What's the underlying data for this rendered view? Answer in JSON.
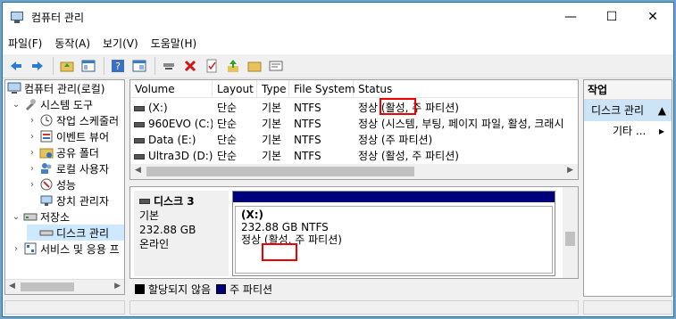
{
  "window": {
    "title": "컴퓨터 관리"
  },
  "menu": [
    "파일(F)",
    "동작(A)",
    "보기(V)",
    "도움말(H)"
  ],
  "tree": {
    "items": [
      {
        "label": "컴퓨터 관리(로컬)"
      },
      {
        "label": "시스템 도구"
      },
      {
        "label": "작업 스케줄러"
      },
      {
        "label": "이벤트 뷰어"
      },
      {
        "label": "공유 폴더"
      },
      {
        "label": "로컬 사용자"
      },
      {
        "label": "성능"
      },
      {
        "label": "장치 관리자"
      },
      {
        "label": "저장소"
      },
      {
        "label": "디스크 관리"
      },
      {
        "label": "서비스 및 응용 프"
      }
    ]
  },
  "table": {
    "columns": [
      "Volume",
      "Layout",
      "Type",
      "File System",
      "Status"
    ],
    "rows": [
      {
        "volume": "(X:)",
        "layout": "단순",
        "type": "기본",
        "fs": "NTFS",
        "status": "정상 (활성, 주 파티션)"
      },
      {
        "volume": "960EVO (C:)",
        "layout": "단순",
        "type": "기본",
        "fs": "NTFS",
        "status": "정상 (시스템, 부팅, 페이지 파일, 활성, 크래시"
      },
      {
        "volume": "Data (E:)",
        "layout": "단순",
        "type": "기본",
        "fs": "NTFS",
        "status": "정상 (주 파티션)"
      },
      {
        "volume": "Ultra3D (D:)",
        "layout": "단순",
        "type": "기본",
        "fs": "NTFS",
        "status": "정상 (활성, 주 파티션)"
      }
    ]
  },
  "disk": {
    "name": "디스크 3",
    "kind": "기본",
    "size": "232.88 GB",
    "state": "온라인",
    "partition": {
      "label": "(X:)",
      "size_fs": "232.88 GB NTFS",
      "status": "정상 (활성, 주 파티션)"
    }
  },
  "legend": {
    "unallocated": "할당되지 않음",
    "primary": "주 파티션",
    "colors": {
      "unallocated": "#000000",
      "primary": "#00007f"
    }
  },
  "actions": {
    "header": "작업",
    "section": "디스크 관리",
    "item": "기타 ..."
  },
  "icons": [
    "back-icon",
    "forward-icon",
    "folder-up-icon",
    "properties-icon",
    "help-icon",
    "console-icon",
    "connect-icon",
    "delete-icon",
    "checklist-icon",
    "upload-icon",
    "folder-icon",
    "settings-icon"
  ]
}
